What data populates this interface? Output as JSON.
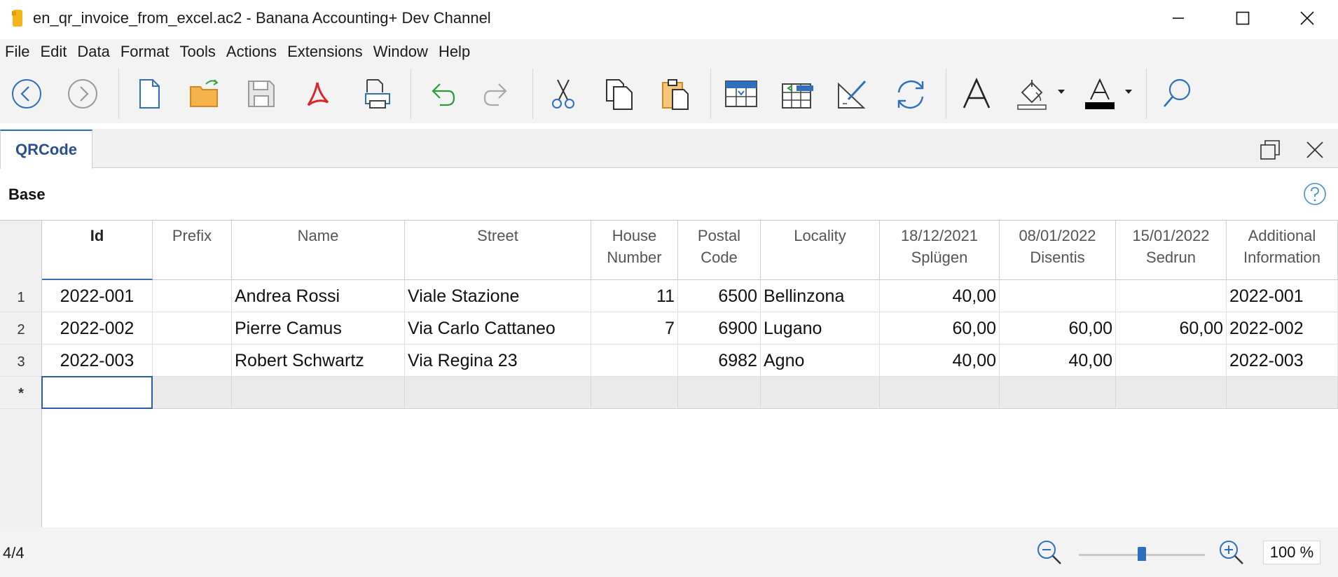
{
  "window": {
    "title": "en_qr_invoice_from_excel.ac2 - Banana Accounting+ Dev Channel"
  },
  "menu": [
    "File",
    "Edit",
    "Data",
    "Format",
    "Tools",
    "Actions",
    "Extensions",
    "Window",
    "Help"
  ],
  "toolbar": {
    "icons": [
      "back-icon",
      "forward-icon",
      "new-file-icon",
      "open-folder-icon",
      "save-icon",
      "pdf-icon",
      "print-icon",
      "undo-icon",
      "redo-icon",
      "cut-icon",
      "copy-icon",
      "paste-icon",
      "insert-row-icon",
      "add-rows-icon",
      "edit-row-icon",
      "recheck-icon",
      "font-icon",
      "fill-color-icon",
      "text-color-icon",
      "search-icon"
    ],
    "accent": "#2f6fbd"
  },
  "tabs": [
    {
      "label": "QRCode",
      "active": true
    }
  ],
  "section": {
    "label": "Base"
  },
  "table": {
    "columns": [
      {
        "line1": "Id",
        "line2": ""
      },
      {
        "line1": "Prefix",
        "line2": ""
      },
      {
        "line1": "Name",
        "line2": ""
      },
      {
        "line1": "Street",
        "line2": ""
      },
      {
        "line1": "House",
        "line2": "Number"
      },
      {
        "line1": "Postal",
        "line2": "Code"
      },
      {
        "line1": "Locality",
        "line2": ""
      },
      {
        "line1": "18/12/2021",
        "line2": "Splügen"
      },
      {
        "line1": "08/01/2022",
        "line2": "Disentis"
      },
      {
        "line1": "15/01/2022",
        "line2": "Sedrun"
      },
      {
        "line1": "Additional",
        "line2": "Information"
      }
    ],
    "rows": [
      {
        "num": "1",
        "cells": [
          "2022-001",
          "",
          "Andrea Rossi",
          "Viale Stazione",
          "11",
          "6500",
          "Bellinzona",
          "40,00",
          "",
          "",
          "2022-001"
        ]
      },
      {
        "num": "2",
        "cells": [
          "2022-002",
          "",
          "Pierre Camus",
          "Via Carlo Cattaneo",
          "7",
          "6900",
          "Lugano",
          "60,00",
          "60,00",
          "60,00",
          "2022-002"
        ]
      },
      {
        "num": "3",
        "cells": [
          "2022-003",
          "",
          "Robert Schwartz",
          "Via Regina 23",
          "",
          "6982",
          "Agno",
          "40,00",
          "40,00",
          "",
          "2022-003"
        ]
      }
    ],
    "new_row_marker": "*"
  },
  "status": {
    "row_count": "4/4",
    "zoom": "100 %",
    "zoom_level": 0.5
  }
}
